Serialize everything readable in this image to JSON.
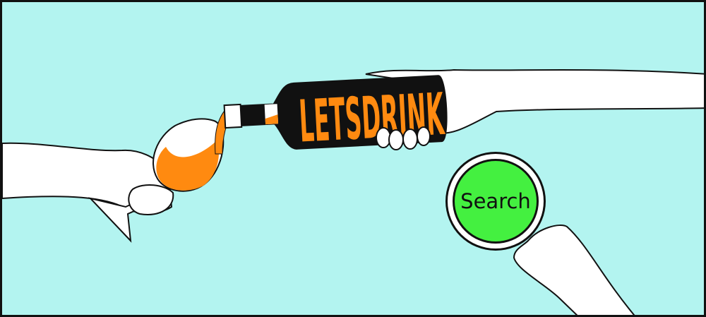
{
  "logo": {
    "text": "LETSDRINK"
  },
  "search_button": {
    "label": "Search"
  },
  "colors": {
    "background": "#b3f4f0",
    "wine": "#ff8a10",
    "button": "#44f040",
    "outline": "#111111"
  }
}
